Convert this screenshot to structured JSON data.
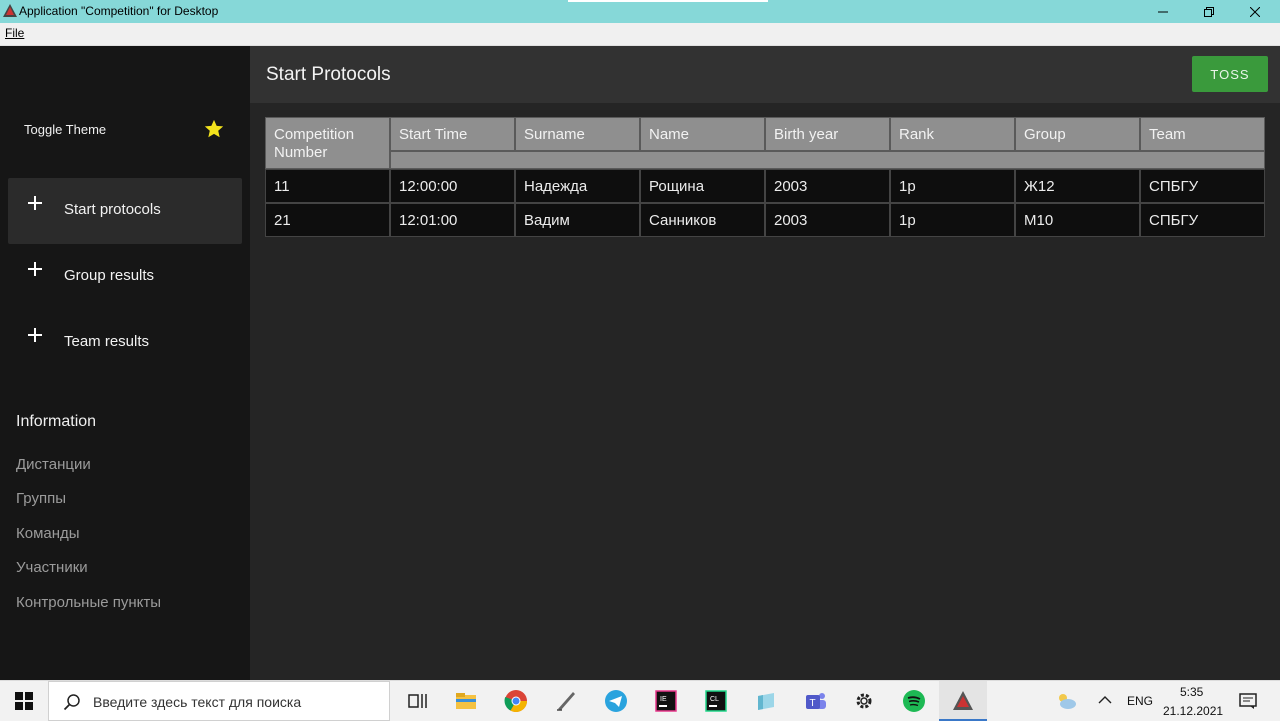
{
  "window": {
    "title": "Application \"Competition\" for Desktop"
  },
  "menu": {
    "file": "File"
  },
  "sidebar": {
    "toggle_theme": "Toggle Theme",
    "nav": [
      {
        "label": "Start protocols",
        "active": true
      },
      {
        "label": "Group results",
        "active": false
      },
      {
        "label": "Team results",
        "active": false
      }
    ],
    "info_title": "Information",
    "info_links": [
      "Дистанции",
      "Группы",
      "Команды",
      "Участники",
      "Контрольные пункты"
    ]
  },
  "main": {
    "title": "Start Protocols",
    "toss_label": "TOSS",
    "table": {
      "headers": [
        "Competition Number",
        "Start Time",
        "Surname",
        "Name",
        "Birth year",
        "Rank",
        "Group",
        "Team"
      ],
      "rows": [
        [
          "11",
          "12:00:00",
          "Надежда",
          "Рощина",
          "2003",
          "1р",
          "Ж12",
          "СПБГУ"
        ],
        [
          "21",
          "12:01:00",
          "Вадим",
          "Санников",
          "2003",
          "1р",
          "М10",
          "СПБГУ"
        ]
      ]
    }
  },
  "taskbar": {
    "search_placeholder": "Введите здесь текст для поиска",
    "lang": "ENG",
    "time": "5:35",
    "date": "21.12.2021"
  }
}
